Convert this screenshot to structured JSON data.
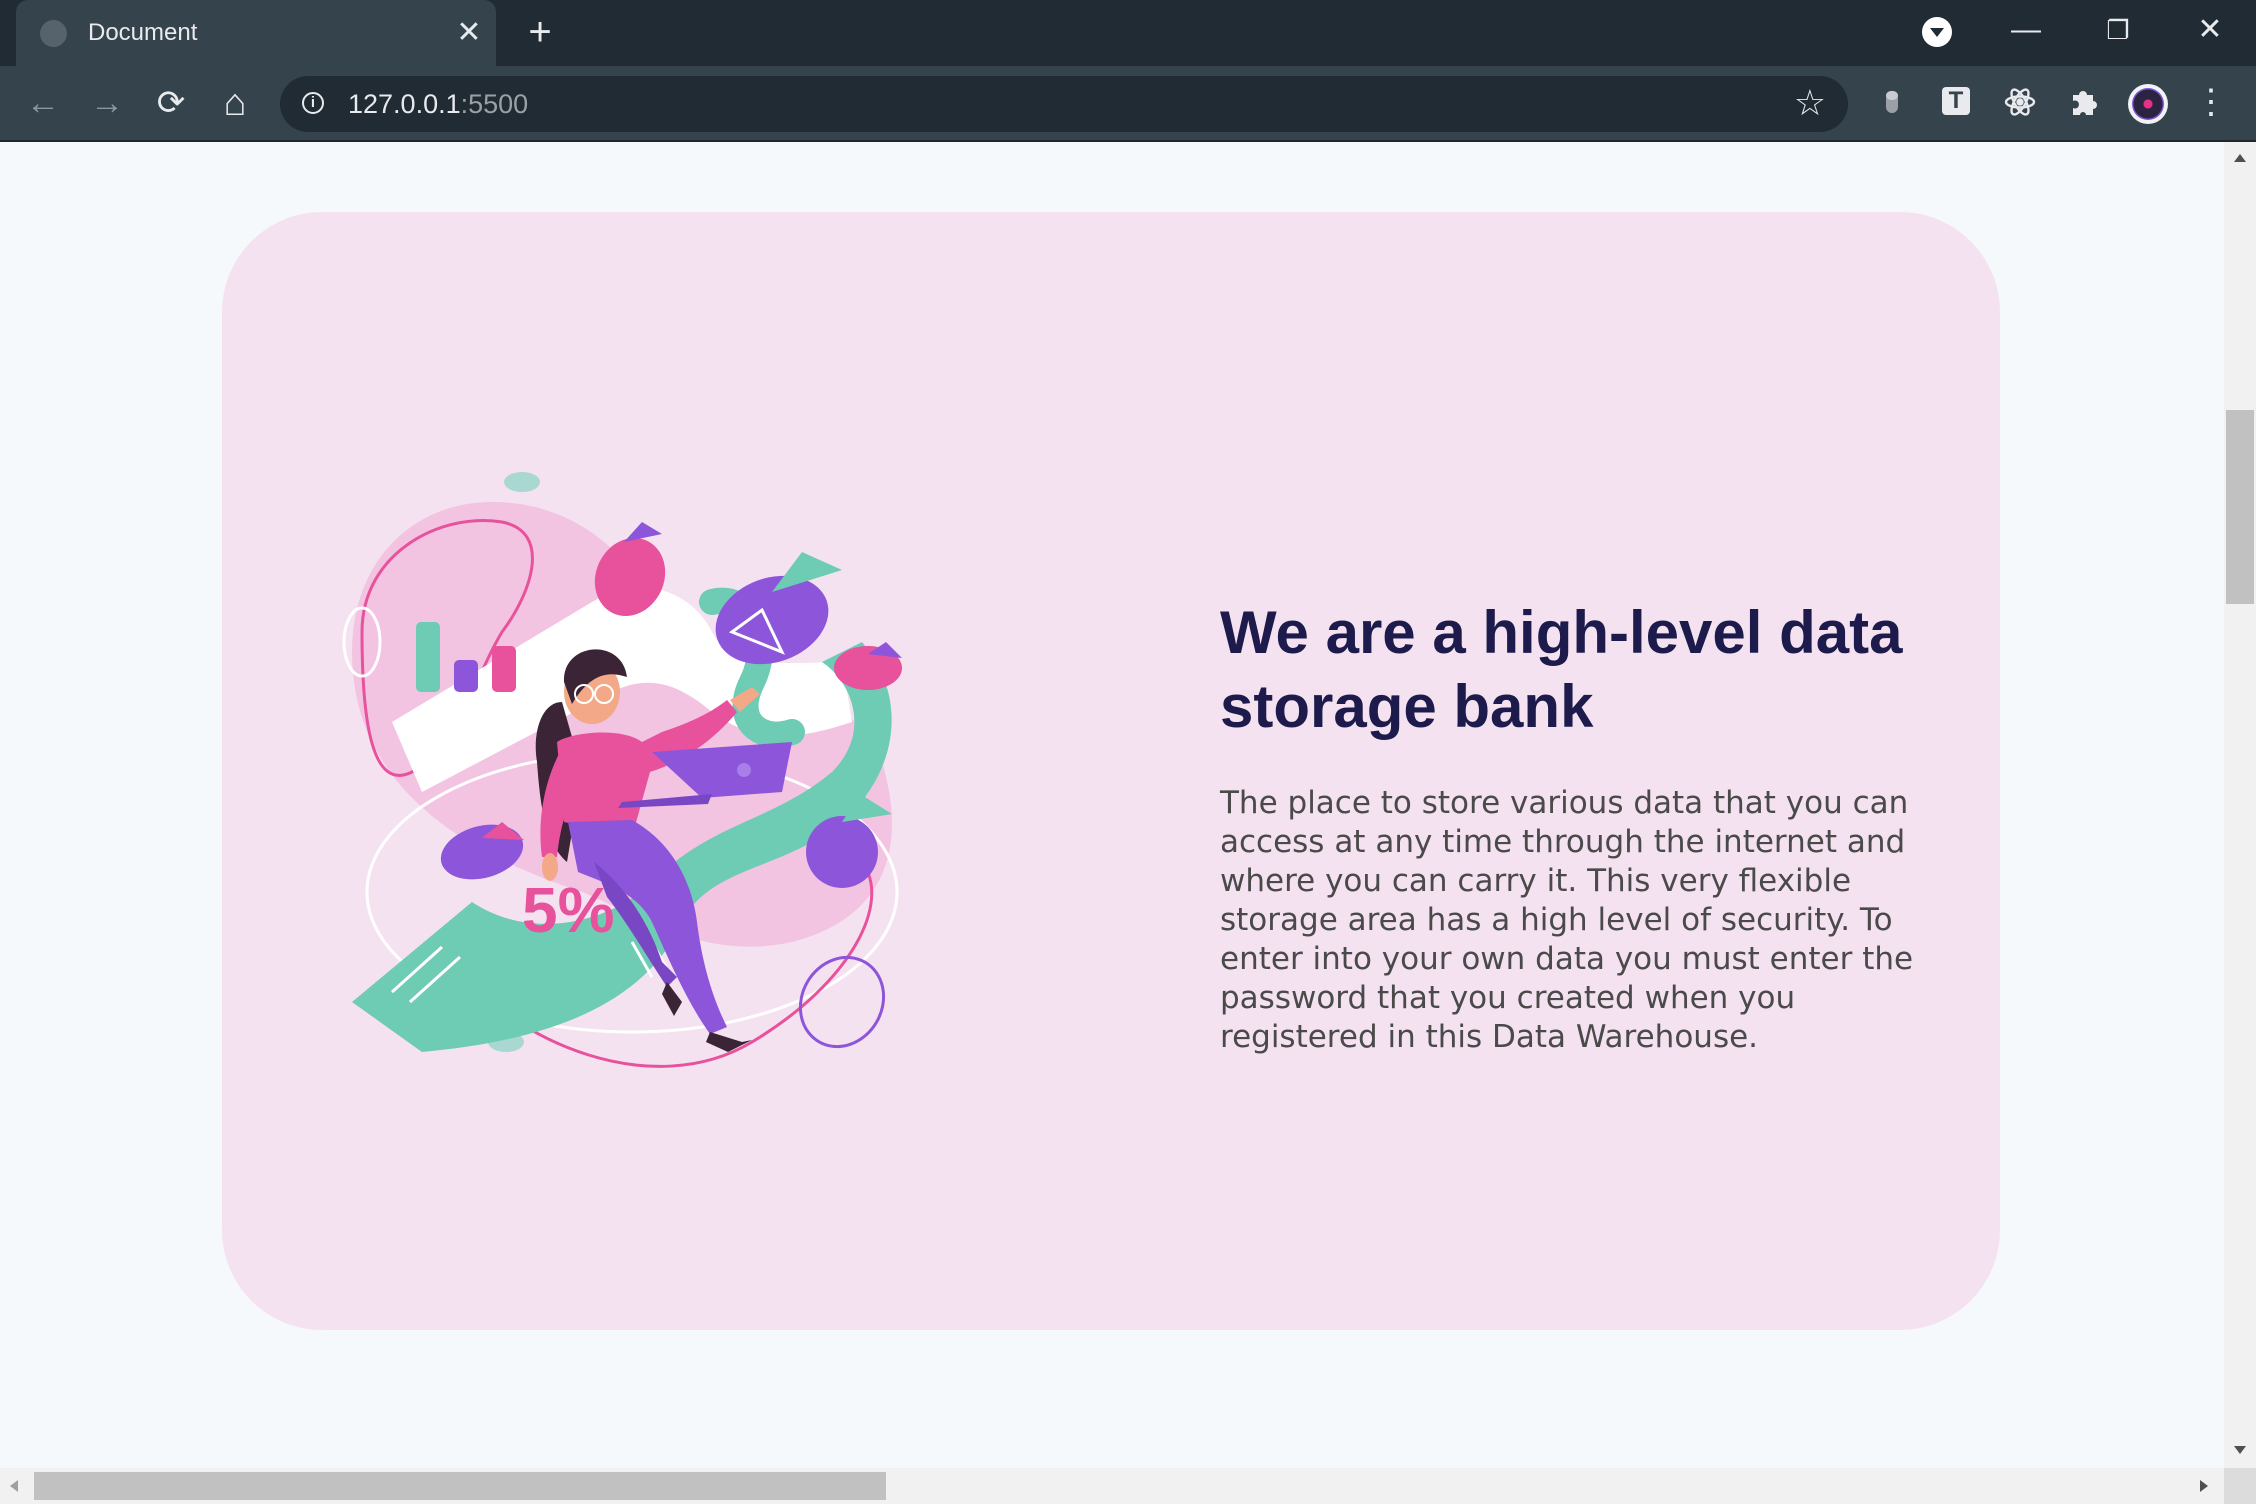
{
  "browser": {
    "tab_title": "Document",
    "tab_close_glyph": "✕",
    "new_tab_glyph": "+",
    "url_host": "127.0.0.1",
    "url_port": ":5500",
    "window_controls": {
      "minimize": "—",
      "restore": "❐",
      "close": "✕"
    },
    "nav": {
      "back": "←",
      "forward": "→",
      "reload": "⟳",
      "home": "⌂"
    },
    "star_glyph": "☆",
    "menu_glyph": "⋮",
    "extension_letter": "T"
  },
  "hero": {
    "title": "We are a high-level data storage bank",
    "description": "The place to store various data that you can access at any time through the internet and where you can carry it. This very flexible storage area has a high level of security. To enter into your own data you must enter the password that you created when you registered in this Data Warehouse.",
    "illustration_label": "5%",
    "colors": {
      "card_background": "#f5e2f1",
      "title": "#1c1b4b",
      "text": "#4a4a4a",
      "accent_pink": "#e8519c",
      "accent_purple": "#8d55d9",
      "accent_teal": "#6ecbb4"
    }
  },
  "icons": {
    "favicon": "globe-icon",
    "info": "info-icon",
    "star": "star-icon",
    "extensions": [
      "mouse-icon",
      "t-extension-icon",
      "react-icon",
      "puzzle-icon"
    ],
    "avatar": "profile-avatar",
    "menu": "kebab-menu-icon"
  }
}
